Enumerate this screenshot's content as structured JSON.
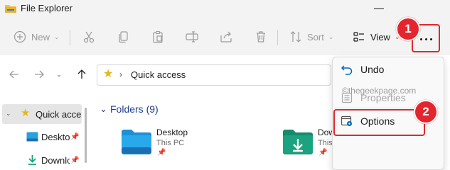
{
  "window": {
    "title": "File Explorer"
  },
  "toolbar": {
    "new_label": "New",
    "sort_label": "Sort",
    "view_label": "View",
    "icons": [
      "cut-icon",
      "copy-icon",
      "paste-icon",
      "rename-icon",
      "share-icon",
      "delete-icon"
    ]
  },
  "address": {
    "path": "Quick access"
  },
  "nav": {
    "items": [
      {
        "label": "Quick acces",
        "icon": "star-icon"
      },
      {
        "label": "Desktop",
        "icon": "desktop-icon"
      },
      {
        "label": "Downlo",
        "icon": "downloads-icon"
      }
    ]
  },
  "content": {
    "section_title": "Folders (9)",
    "folders": [
      {
        "name": "Desktop",
        "location": "This PC"
      },
      {
        "name": "Dow",
        "location": "This PC"
      }
    ]
  },
  "menu": {
    "items": [
      {
        "label": "Undo",
        "enabled": true
      },
      {
        "label": "Properties",
        "enabled": false
      },
      {
        "label": "Options",
        "enabled": true
      }
    ],
    "watermark": "©thegeekpage.com"
  },
  "annotations": {
    "step1": "1",
    "step2": "2",
    "color": "#e3262d"
  },
  "colors": {
    "accent": "#0067c0",
    "folder_blue": "#1e90d6",
    "folder_green": "#1aa37e",
    "star": "#e8b715"
  }
}
